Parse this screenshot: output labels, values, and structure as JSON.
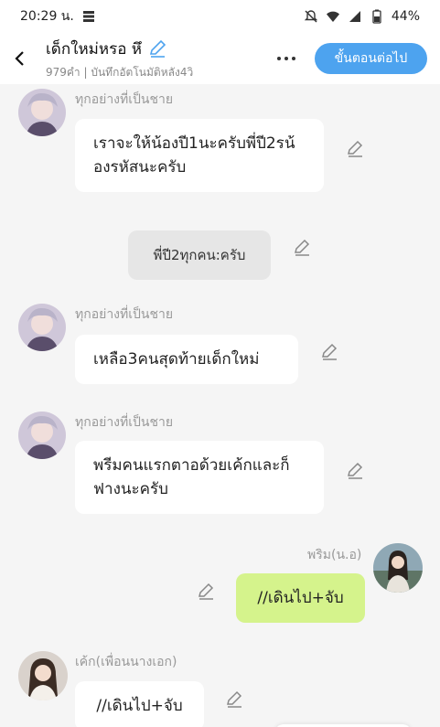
{
  "status_bar": {
    "time": "20:29 น.",
    "battery": "44%",
    "icons": [
      "storage-icon",
      "mute-icon",
      "wifi-icon",
      "signal-icon",
      "battery-icon"
    ]
  },
  "header": {
    "title": "เด็กใหม่หรอ หึ",
    "subtitle": "979คำ | บันทึกอัตโนมัติหลัง4วิ",
    "next_button": "ขั้นตอนต่อไป"
  },
  "messages": [
    {
      "type": "character",
      "name": "ทุกอย่างที่เป็นชาย",
      "text": "เราจะให้น้องปี1นะครับพี่ปี2รน้องรหัสนะครับ"
    },
    {
      "type": "narration",
      "text": "พี่ปี2ทุกคน:ครับ"
    },
    {
      "type": "character",
      "name": "ทุกอย่างที่เป็นชาย",
      "text": "เหลือ3คนสุดท้ายเด็กใหม่"
    },
    {
      "type": "character",
      "name": "ทุกอย่างที่เป็นชาย",
      "text": "พรีมคนแรกตาอด้วยเค้กและก็ฟางนะครับ"
    },
    {
      "type": "self",
      "name": "พริม(น.อ)",
      "text": "//เดินไป+จับ"
    },
    {
      "type": "character",
      "name": "เค้ก(เพื่อนนางเอก)",
      "text": "//เดินไป+จับ"
    }
  ],
  "colors": {
    "accent": "#4da3ef",
    "self_bubble": "#d5f38c",
    "narration_bubble": "#e6e6e6",
    "background": "#f5f5f5"
  }
}
